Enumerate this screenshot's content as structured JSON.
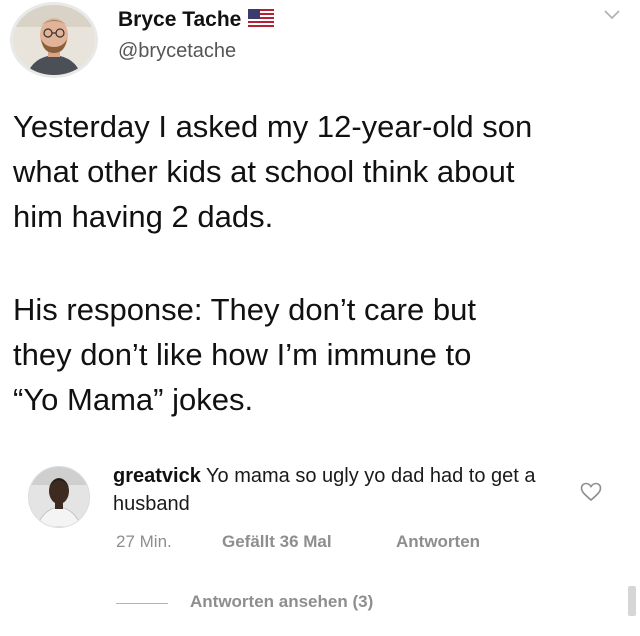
{
  "tweet": {
    "display_name": "Bryce Tache",
    "handle": "@brycetache",
    "avatar_icon": "profile-photo-man-beard",
    "flag_icon": "us-flag-icon",
    "menu_icon": "chevron-down-icon",
    "paragraph1": [
      "Yesterday I asked my 12-year-old son",
      "what other kids at school think about",
      "him having 2 dads."
    ],
    "paragraph2": [
      "His response: They don’t care but",
      "they don’t like how I’m immune to",
      "“Yo Mama” jokes."
    ]
  },
  "comment": {
    "username": "greatvick",
    "text": "Yo mama so ugly yo dad had to get a husband",
    "time": "27 Min.",
    "likes": "Gefällt 36 Mal",
    "reply_label": "Antworten",
    "view_replies": "Antworten ansehen (3)",
    "avatar_icon": "profile-photo-man",
    "like_icon": "heart-icon"
  },
  "colors": {
    "text": "#111111",
    "secondary_text": "#8e8e8e",
    "background": "#ffffff"
  }
}
